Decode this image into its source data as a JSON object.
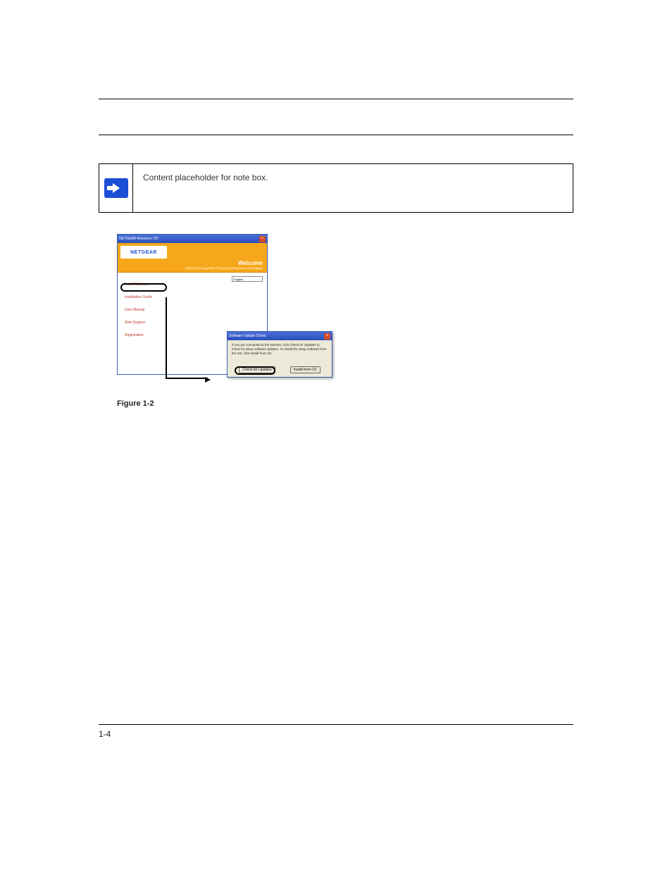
{
  "note": {
    "text": "Content placeholder for note box."
  },
  "figure_caption": "Figure 1-2",
  "page_number": "1-4",
  "cd_window": {
    "title": "NETGEAR Resource CD",
    "logo": "NETGEAR",
    "welcome": "Welcome",
    "subwelcome": "WNDA3100 RangeMax™ Dual Band Wireless-N USB Adapter",
    "language_value": "English",
    "links": [
      "Install Software",
      "Installation Guide",
      "User Manual",
      "Web Support",
      "Registration"
    ]
  },
  "update_dialog": {
    "title": "Software Update Check",
    "body": "If you are connected to the Internet, click Check for Updates to check for setup software updates. To install the setup software from the CD, click Install from CD.",
    "check_btn": "Check for Updates",
    "install_btn": "Install from CD"
  }
}
